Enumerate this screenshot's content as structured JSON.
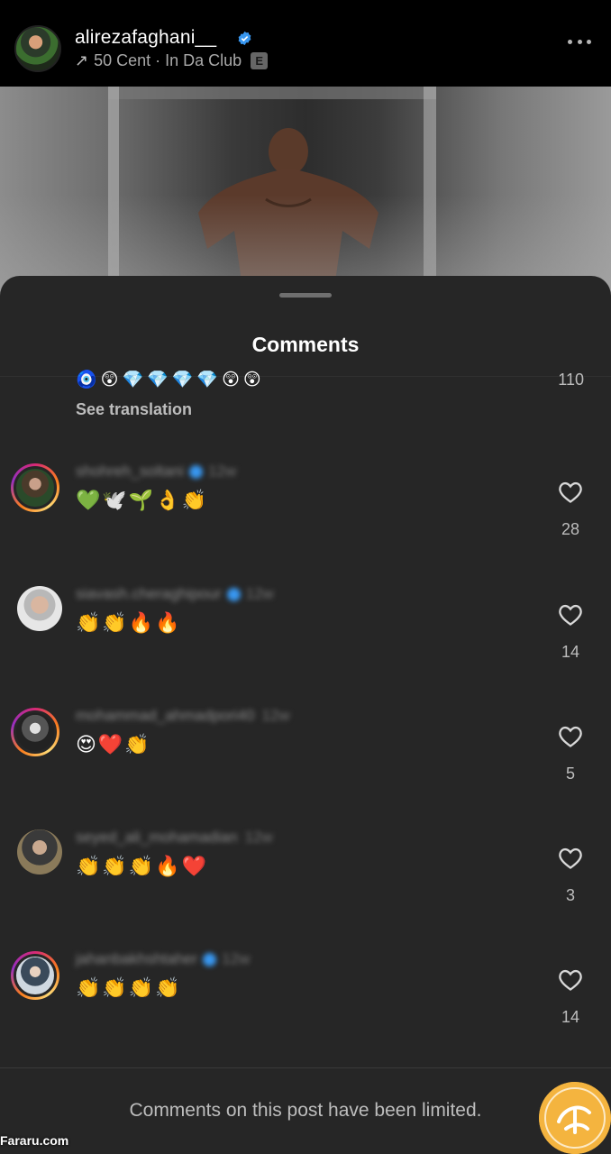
{
  "header": {
    "username": "alirezafaghani__",
    "music": "50 Cent · In Da Club",
    "explicit_badge": "E",
    "icons": [
      "verified-icon",
      "arrow-up-right-icon",
      "more-icon"
    ]
  },
  "sheet": {
    "title": "Comments",
    "previous": {
      "emoji": "🧿😲💎💎💎💎😲😲",
      "count": "110",
      "see_translation": "See translation"
    },
    "comments": [
      {
        "username": "shohreh_soltani",
        "verified": true,
        "time": "12w",
        "text": "💚🕊️🌱👌👏",
        "likes": "28",
        "ring": true
      },
      {
        "username": "siavash.cheraghipour",
        "verified": true,
        "time": "12w",
        "text": "👏👏🔥🔥",
        "likes": "14",
        "ring": false
      },
      {
        "username": "mohammad_ahmadpori40",
        "verified": false,
        "time": "12w",
        "text": "😍❤️👏",
        "likes": "5",
        "ring": true
      },
      {
        "username": "seyed_ali_mohamadian",
        "verified": false,
        "time": "12w",
        "text": "👏👏👏🔥❤️",
        "likes": "3",
        "ring": false
      },
      {
        "username": "jahanbakhshtaher",
        "verified": true,
        "time": "12w",
        "text": "👏👏👏👏",
        "likes": "14",
        "ring": true
      }
    ],
    "limited_notice": "Comments on this post have been limited."
  },
  "watermark": {
    "text": "Fararu.com"
  },
  "colors": {
    "background": "#000000",
    "sheet": "#262626",
    "verified": "#3897f0",
    "muted": "#bdbdbd",
    "logo": "#f4b43f"
  }
}
